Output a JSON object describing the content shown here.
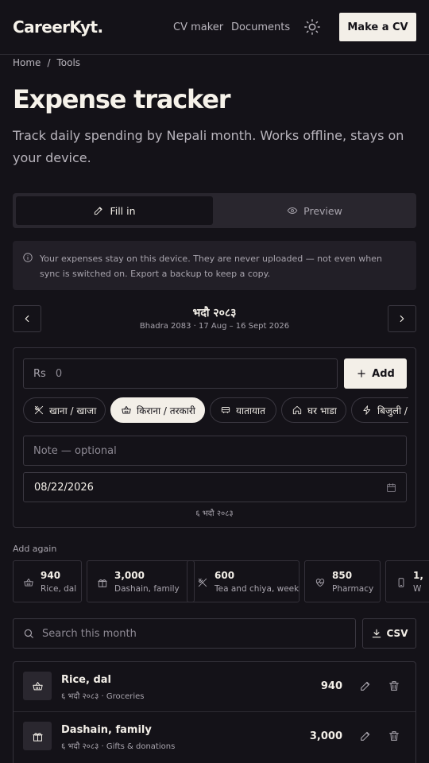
{
  "header": {
    "logo": "CareerKyt.",
    "nav": [
      "CV maker",
      "Documents"
    ],
    "theme_icon": "sun-icon",
    "cta": "Make a CV"
  },
  "breadcrumb": [
    "Home",
    "/",
    "Tools"
  ],
  "page": {
    "title": "Expense tracker",
    "subtitle": "Track daily spending by Nepali month. Works offline, stays on your device."
  },
  "tabs": [
    {
      "label": "Fill in",
      "icon": "pencil-icon",
      "active": true
    },
    {
      "label": "Preview",
      "icon": "eye-icon",
      "active": false
    }
  ],
  "notice": "Your expenses stay on this device. They are never uploaded — not even when sync is switched on. Export a backup to keep a copy.",
  "month": {
    "title": "भदौ २०८३",
    "subtitle": "Bhadra 2083 · 17 Aug – 16 Sept 2026"
  },
  "form": {
    "currency": "Rs",
    "amount_placeholder": "0",
    "add_label": "Add",
    "categories": [
      {
        "label": "खाना / खाजा",
        "icon": "fork-knife-icon",
        "selected": false
      },
      {
        "label": "किराना / तरकारी",
        "icon": "basket-icon",
        "selected": true
      },
      {
        "label": "यातायात",
        "icon": "bus-icon",
        "selected": false
      },
      {
        "label": "घर भाडा",
        "icon": "home-icon",
        "selected": false
      },
      {
        "label": "बिजुली / पानी",
        "icon": "lightning-icon",
        "selected": false
      }
    ],
    "note_placeholder": "Note — optional",
    "date_value": "08/22/2026",
    "date_caption": "६ भदौ २०८३"
  },
  "add_again": {
    "label": "Add again",
    "items": [
      {
        "amount": "940",
        "label": "Rice, dal",
        "icon": "basket-icon"
      },
      {
        "amount": "3,000",
        "label": "Dashain, family",
        "icon": "gift-icon"
      },
      {
        "amount": "600",
        "label": "Tea and chiya, week",
        "icon": "fork-knife-icon"
      },
      {
        "amount": "850",
        "label": "Pharmacy",
        "icon": "heart-pulse-icon"
      },
      {
        "amount": "1,",
        "label": "W",
        "icon": "phone-icon"
      }
    ]
  },
  "search": {
    "placeholder": "Search this month",
    "csv": "CSV"
  },
  "entries": [
    {
      "title": "Rice, dal",
      "meta": "६ भदौ २०८३ · Groceries",
      "amount": "940",
      "icon": "basket-icon"
    },
    {
      "title": "Dashain, family",
      "meta": "६ भदौ २०८३ · Gifts & donations",
      "amount": "3,000",
      "icon": "gift-icon"
    }
  ]
}
